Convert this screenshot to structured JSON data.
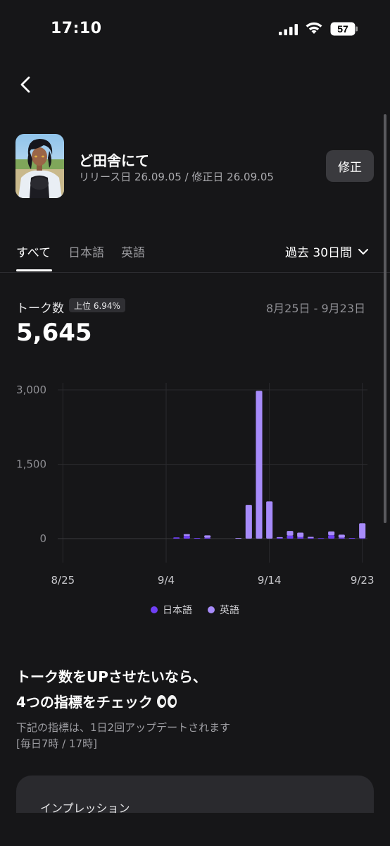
{
  "status_bar": {
    "time": "17:10",
    "battery": "57"
  },
  "character": {
    "name": "ど田舎にて",
    "meta": "リリース日 26.09.05 / 修正日 26.09.05",
    "edit_label": "修正"
  },
  "tabs": [
    {
      "label": "すべて",
      "active": true
    },
    {
      "label": "日本語",
      "active": false
    },
    {
      "label": "英語",
      "active": false
    }
  ],
  "period_label": "過去 30日間",
  "stats": {
    "label": "トーク数",
    "rank_badge": "上位 6.94%",
    "date_range": "8月25日 - 9月23日",
    "total": "5,645"
  },
  "chart_data": {
    "type": "bar",
    "stacked": true,
    "x": [
      "8/25",
      "8/26",
      "8/27",
      "8/28",
      "8/29",
      "8/30",
      "8/31",
      "9/1",
      "9/2",
      "9/3",
      "9/4",
      "9/5",
      "9/6",
      "9/7",
      "9/8",
      "9/9",
      "9/10",
      "9/11",
      "9/12",
      "9/13",
      "9/14",
      "9/15",
      "9/16",
      "9/17",
      "9/18",
      "9/19",
      "9/20",
      "9/21",
      "9/22",
      "9/23"
    ],
    "x_tick_labels": [
      "8/25",
      "9/4",
      "9/14",
      "9/23"
    ],
    "y_ticks": [
      "3,000",
      "1,500",
      "0"
    ],
    "ylim": [
      0,
      3000
    ],
    "series": [
      {
        "name": "日本語",
        "color": "#6f3ff5",
        "values": [
          0,
          0,
          0,
          0,
          0,
          0,
          0,
          0,
          0,
          0,
          0,
          25,
          55,
          15,
          20,
          0,
          0,
          0,
          0,
          0,
          0,
          20,
          60,
          30,
          15,
          10,
          70,
          20,
          15,
          10
        ]
      },
      {
        "name": "英語",
        "color": "#a78bfa",
        "values": [
          0,
          0,
          0,
          0,
          0,
          0,
          0,
          0,
          0,
          0,
          0,
          0,
          35,
          0,
          45,
          0,
          0,
          15,
          680,
          2980,
          750,
          10,
          95,
          90,
          20,
          0,
          75,
          60,
          0,
          300
        ]
      }
    ],
    "legend_position": "bottom-center"
  },
  "promo": {
    "line1": "トーク数をUPさせたいなら、",
    "line2": "4つの指標をチェック",
    "note1": "下記の指標は、1日2回アップデートされます",
    "note2": "[毎日7時 / 17時]",
    "card_label": "インプレッション"
  },
  "colors": {
    "background": "#161618",
    "accent_dark": "#6f3ff5",
    "accent_light": "#a78bfa"
  }
}
